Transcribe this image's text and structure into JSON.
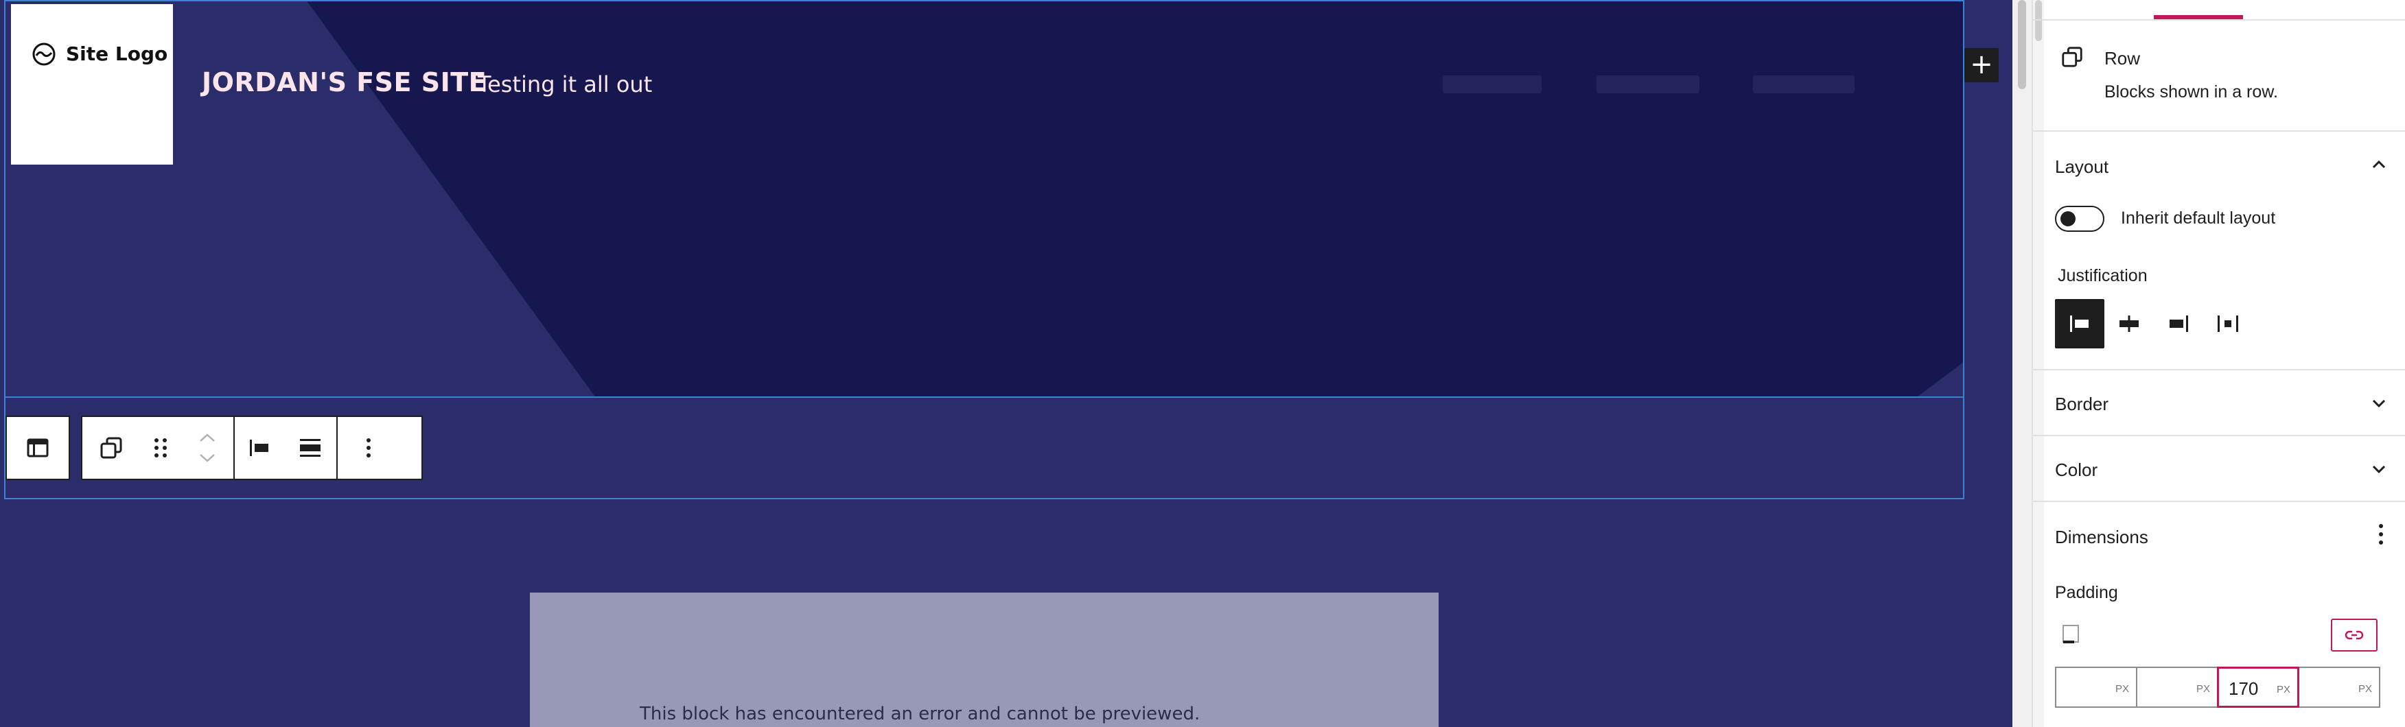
{
  "canvas": {
    "site_logo_label": "Site Logo",
    "site_title": "JORDAN'S FSE SITE",
    "site_tagline": "Testing it all out",
    "inserter_symbol": "+",
    "error_message": "This block has encountered an error and cannot be previewed."
  },
  "toolbar": {
    "buttons": [
      "block-type-icon",
      "transform-icon",
      "drag-handle-icon",
      "move-up-icon",
      "move-down-icon",
      "justify-left-icon",
      "vertical-align-icon",
      "more-options-icon"
    ]
  },
  "sidebar": {
    "block_card": {
      "name": "Row",
      "description": "Blocks shown in a row."
    },
    "layout": {
      "title": "Layout",
      "inherit_label": "Inherit default layout",
      "inherit_enabled": false,
      "justification_label": "Justification",
      "justification_selected": "left"
    },
    "panels": [
      {
        "title": "Border"
      },
      {
        "title": "Color"
      }
    ],
    "dimensions": {
      "title": "Dimensions",
      "padding_label": "Padding",
      "padding_values": [
        "",
        "",
        "170",
        ""
      ],
      "unit": "PX"
    },
    "accent_color": "#c2185b"
  }
}
